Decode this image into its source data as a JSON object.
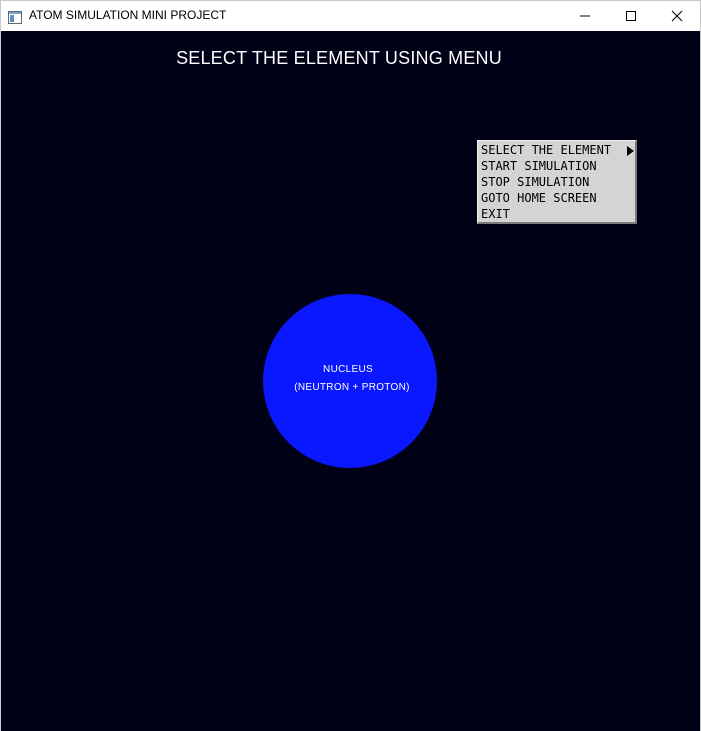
{
  "window": {
    "title": "ATOM SIMULATION MINI PROJECT",
    "icon": "app-window-icon",
    "controls": [
      "minimize-icon",
      "maximize-icon",
      "close-icon"
    ]
  },
  "canvas": {
    "background_color": "#000016",
    "heading": "SELECT THE ELEMENT USING MENU",
    "nucleus": {
      "color": "#0a18ff",
      "label_line1": "NUCLEUS",
      "label_line2": "(NEUTRON + PROTON)"
    }
  },
  "context_menu": {
    "items": [
      {
        "label": "SELECT THE ELEMENT",
        "has_submenu": true
      },
      {
        "label": "START SIMULATION",
        "has_submenu": false
      },
      {
        "label": "STOP SIMULATION",
        "has_submenu": false
      },
      {
        "label": "GOTO HOME SCREEN",
        "has_submenu": false
      },
      {
        "label": "EXIT",
        "has_submenu": false
      }
    ]
  }
}
